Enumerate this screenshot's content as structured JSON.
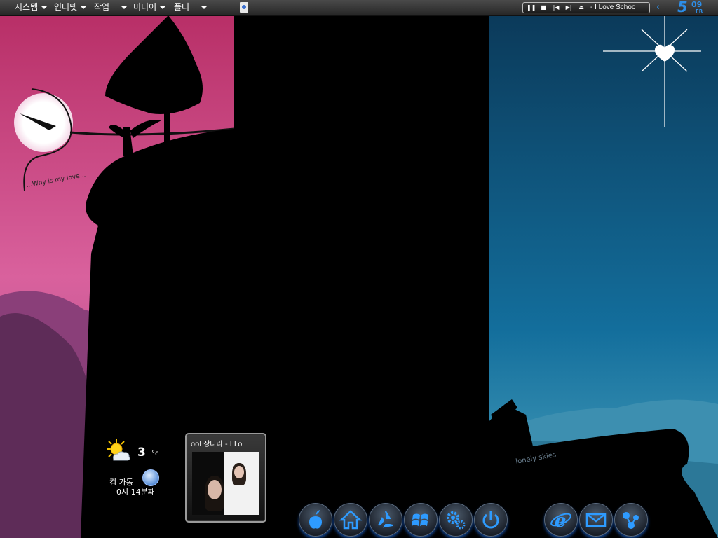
{
  "menubar": {
    "items": [
      {
        "label": "시스템"
      },
      {
        "label": "인터넷"
      },
      {
        "label": "작업"
      },
      {
        "label": "미디어"
      },
      {
        "label": "폴더"
      }
    ]
  },
  "player": {
    "controls": [
      "pause",
      "stop",
      "previous",
      "next",
      "eject"
    ],
    "track": "- I Love Schoo"
  },
  "clock": {
    "hour": "5",
    "minute": "09",
    "day": "FR"
  },
  "wallpaper": {
    "caption_left": "...Why is my love...",
    "caption_right": "lonely skies"
  },
  "weather": {
    "temperature": "3",
    "unit": "°c",
    "location": "컴 가동",
    "updated": "0시 14분째",
    "icon": "partly-sunny-icon"
  },
  "now_playing": {
    "title": "ool 장나라 - I Lo"
  },
  "dock": {
    "items": [
      "apple-icon",
      "home-icon",
      "recycle-icon",
      "windows-icon",
      "settings-icon",
      "power-icon",
      "internet-explorer-icon",
      "mail-icon",
      "network-icon"
    ]
  },
  "colors": {
    "sky_left": "#d04a8a",
    "sky_right": "#0e6aa0",
    "accent_blue": "#2d8ee8"
  }
}
